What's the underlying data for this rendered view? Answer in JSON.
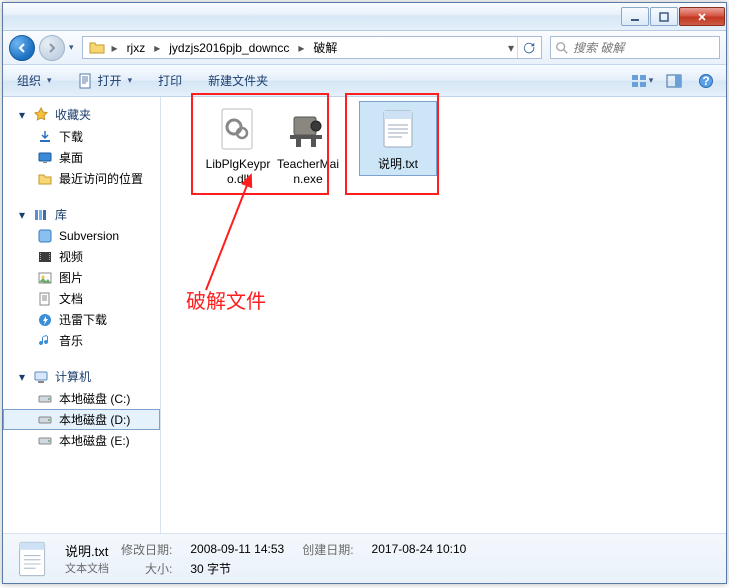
{
  "title_window": "",
  "breadcrumb": {
    "seg1": "rjxz",
    "seg2": "jydzjs2016pjb_downcc",
    "seg3": "破解"
  },
  "search": {
    "placeholder": "搜索 破解"
  },
  "toolbar": {
    "organize": "组织",
    "open": "打开",
    "print": "打印",
    "newfolder": "新建文件夹"
  },
  "sidebar": {
    "favorites": {
      "title": "收藏夹",
      "downloads": "下载",
      "desktop": "桌面",
      "recent": "最近访问的位置"
    },
    "libraries": {
      "title": "库",
      "svn": "Subversion",
      "videos": "视频",
      "pictures": "图片",
      "documents": "文档",
      "thunder": "迅雷下载",
      "music": "音乐"
    },
    "computer": {
      "title": "计算机",
      "c": "本地磁盘 (C:)",
      "d": "本地磁盘 (D:)",
      "e": "本地磁盘 (E:)"
    }
  },
  "files": {
    "f1": "LibPlgKeypro.dll",
    "f2": "TeacherMain.exe",
    "f3": "说明.txt"
  },
  "annotation": "破解文件",
  "status": {
    "filename": "说明.txt",
    "filetype": "文本文档",
    "modlabel": "修改日期:",
    "modval": "2008-09-11 14:53",
    "sizelabel": "大小:",
    "sizeval": "30 字节",
    "createlabel": "创建日期:",
    "createval": "2017-08-24 10:10"
  }
}
